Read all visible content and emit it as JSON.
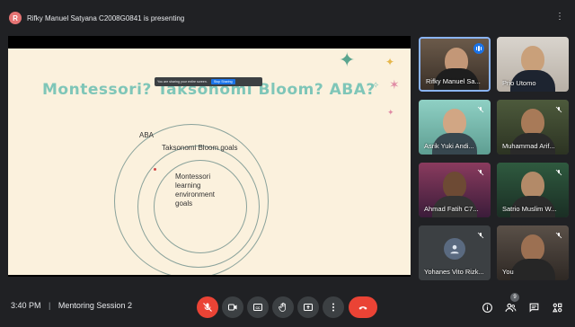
{
  "presenting": {
    "avatar_letter": "R",
    "text": "Rifky Manuel Satyana C2008G0841 is presenting"
  },
  "slide": {
    "title": "Montessori? Taksonomi Bloom? ABA?",
    "share_bar_text": "You are sharing your entire screen.",
    "share_bar_stop": "Stop Sharing",
    "rings": {
      "outer": "ABA",
      "middle": "Taksonomi Bloom goals",
      "inner_lines": [
        "Montessori",
        "learning",
        "environment",
        "goals"
      ]
    }
  },
  "participants": [
    {
      "name": "Rifky Manuel Sa...",
      "speaking": true,
      "muted": false
    },
    {
      "name": "Prio Utomo",
      "speaking": false,
      "muted": false
    },
    {
      "name": "Asrik Yuki Andi...",
      "speaking": false,
      "muted": true
    },
    {
      "name": "Muhammad Arif...",
      "speaking": false,
      "muted": true
    },
    {
      "name": "Ahmad Fatih C7...",
      "speaking": false,
      "muted": true
    },
    {
      "name": "Satrio Muslim W...",
      "speaking": false,
      "muted": true
    },
    {
      "name": "Yohanes Vito Rizk...",
      "speaking": false,
      "muted": true
    },
    {
      "name": "You",
      "speaking": false,
      "muted": true
    }
  ],
  "meeting": {
    "time": "3:40 PM",
    "separator": "|",
    "title": "Mentoring Session 2"
  },
  "people_count": "9",
  "colors": {
    "slide_bg": "#fbf1dd",
    "title": "#7fc6b8",
    "hangup": "#ea4335",
    "speaking": "#1a73e8"
  }
}
